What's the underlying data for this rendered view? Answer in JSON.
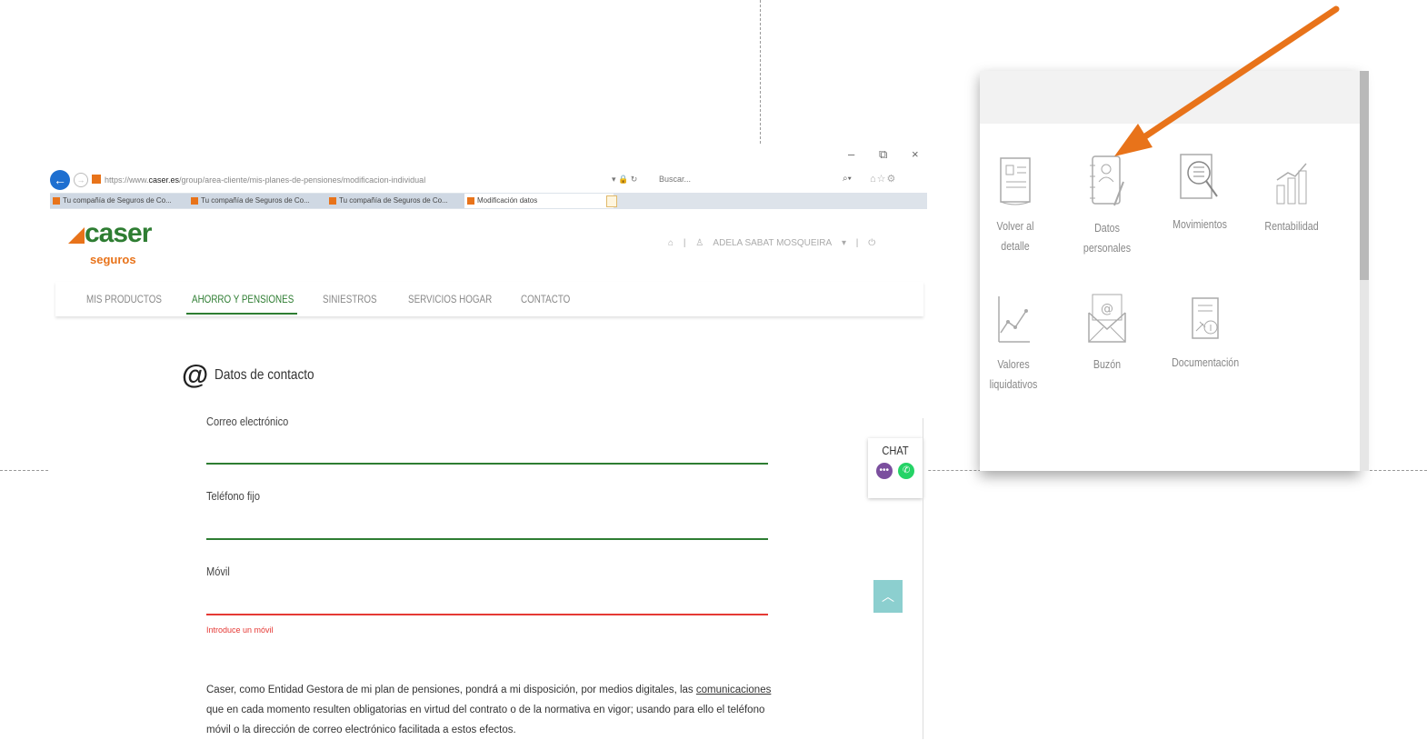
{
  "browser": {
    "url_prefix": "https://www.",
    "url_domain": "caser.es",
    "url_path": "/group/area-cliente/mis-planes-de-pensiones/modificacion-individual",
    "search_placeholder": "Buscar...",
    "window_minimize": "–",
    "window_restore": "⧉",
    "window_close": "×",
    "tabs": [
      {
        "label": "Tu compañía de Seguros de Co..."
      },
      {
        "label": "Tu compañía de Seguros de Co..."
      },
      {
        "label": "Tu compañía de Seguros de Co..."
      },
      {
        "label": "Modificación datos"
      }
    ]
  },
  "site": {
    "logo_word": "caser",
    "logo_sub": "seguros",
    "user_name": "ADELA SABAT MOSQUEIRA",
    "nav": [
      {
        "label": "MIS PRODUCTOS"
      },
      {
        "label": "AHORRO Y PENSIONES"
      },
      {
        "label": "SINIESTROS"
      },
      {
        "label": "SERVICIOS HOGAR"
      },
      {
        "label": "CONTACTO"
      }
    ]
  },
  "contact": {
    "title": "Datos de contacto",
    "email_label": "Correo electrónico",
    "phone_label": "Teléfono fijo",
    "mobile_label": "Móvil",
    "mobile_error": "Introduce un móvil",
    "legal_before": "Caser, como Entidad Gestora de mi plan de pensiones, pondrá a mi disposición, por medios digitales, las ",
    "legal_link": "comunicaciones",
    "legal_after": " que en cada momento resulten obligatorias en virtud del contrato o de la normativa en vigor; usando para ello el teléfono móvil o la dirección de correo electrónico facilitada a estos efectos."
  },
  "chat": {
    "label": "CHAT"
  },
  "menu": {
    "items": [
      {
        "label1": "Volver al",
        "label2": "detalle",
        "icon": "document-icon"
      },
      {
        "label1": "Datos",
        "label2": "personales",
        "icon": "address-book-icon"
      },
      {
        "label1": "Movimientos",
        "label2": "",
        "icon": "list-search-icon"
      },
      {
        "label1": "Rentabilidad",
        "label2": "",
        "icon": "bar-chart-icon"
      },
      {
        "label1": "Valores",
        "label2": "liquidativos",
        "icon": "line-chart-icon"
      },
      {
        "label1": "Buzón",
        "label2": "",
        "icon": "envelope-icon"
      },
      {
        "label1": "Documentación",
        "label2": "",
        "icon": "document-info-icon"
      }
    ]
  },
  "colors": {
    "accent_orange": "#e8731a",
    "brand_green": "#2e7d32",
    "error_red": "#e53935"
  }
}
